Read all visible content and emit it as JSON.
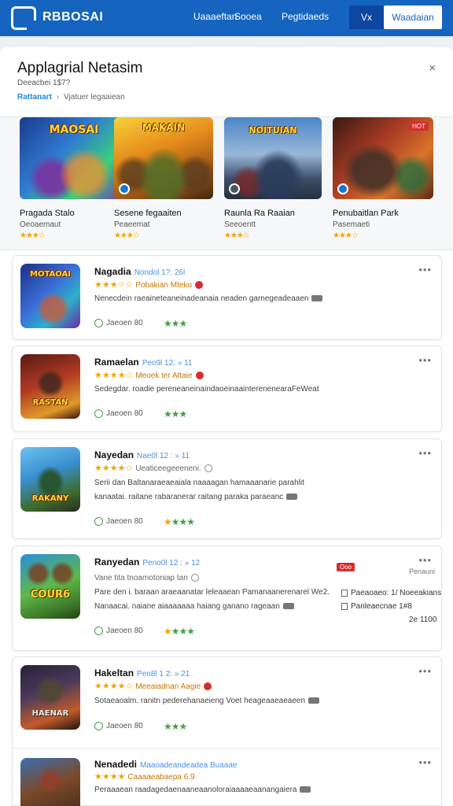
{
  "nav": {
    "brand": "RBBOSAI",
    "links": [
      "Uaaaeftan",
      "Sooea",
      "Pegtidaeds"
    ],
    "btn_a": "Vx",
    "btn_b": "Waadaian"
  },
  "header": {
    "title": "Applagrial Netasim",
    "subtitle": "Deeacbei 1$7?",
    "crumb_1": "Rattanart",
    "crumb_sep": "›",
    "crumb_2": "Vjatuer legaaiean",
    "close": "×"
  },
  "featured": [
    {
      "art_title": "MAOSAI",
      "title": "Pragada Stalo",
      "sub": "Oeoaemaut",
      "stars": "★★★☆"
    },
    {
      "art_title": "MAKAIN",
      "title": "Sesene fegaaiten",
      "sub": "Peaeemat",
      "stars": "★★★☆"
    },
    {
      "art_title": "NOITUIAN",
      "title": "Raunla Ra Raaian",
      "sub": "Seeoentt",
      "stars": "★★★☆"
    },
    {
      "art_title": "",
      "title": "Penubaitlan Park",
      "sub": "Pasemaeti",
      "stars": "★★★☆",
      "hot": "HOT"
    }
  ],
  "cards": [
    {
      "art_title": "MOTAOAI",
      "title": "Nagadia",
      "meta": "Nondol 1?: 26l",
      "stars": "★★★☆☆",
      "tag": "Pobakian Mteko",
      "desc": [
        "Nenecdein raeaineteaneinadeanaia neaden garnegeadeaaen"
      ],
      "check": "Jaeoen 80",
      "rating": "★★★"
    },
    {
      "art_title": "RASTAN",
      "title": "Ramaelan",
      "meta": "Peo9l 12: » 11",
      "stars": "★★★★☆",
      "tag": "Meoek ter Attaie",
      "desc": [
        "Sedegdar. roadie pereneaneinaindaoeinaainterenenearaFeWeat"
      ],
      "check": "Jaeoen 80",
      "rating": "★★★"
    },
    {
      "art_title": "RAKANY",
      "title": "Nayedan",
      "meta": "Nae0l 12 : » 11",
      "stars": "★★★★☆",
      "tag": "Ueaticeegeeeneni.",
      "desc": [
        "Serii dan  Baltanaraeaeaiala naaaagan hamaaanarie parahlit",
        "kanaatai. raitane rabaranerar raitang paraka paraeanc"
      ],
      "check": "Jaeoen 80",
      "rating": "★★★"
    },
    {
      "art_title": "COUR6",
      "title": "Ranyedan",
      "meta": "Peno0l 12 : » 12",
      "stars": "",
      "tag": "Vane tita tnoamotoniap tan",
      "desc": [
        "Pare den i. baraan araeaanatar leleaaean Pamanaanerenarel We2.",
        "Nanaacai. naiane aiaaaaaaa haiang ganano rageaan"
      ],
      "check": "Jaeoen 80",
      "rating": "★★★",
      "side_badge": "Ooo",
      "side_label": "Penauni",
      "side_row_1": "Paeaoaeo: 1/ Noeeakians",
      "side_row_2": "Panleaecnae 1#8",
      "side_small": "2e 1100"
    },
    {
      "art_title": "HAENAR",
      "title": "Hakeltan",
      "meta": "Pen8l 1 2: » 21",
      "stars": "★★★★☆",
      "tag": "Meeaiadnan Aagie",
      "desc": [
        "Sotaeaoalm. ranitn pederehanaeieng Voet heageaaeaeaeen"
      ],
      "check": "Jaeoen 80",
      "rating": "★★★"
    },
    {
      "art_title": "",
      "title": "Nenadedi",
      "meta": "Maaoadeandeadea Buaaae",
      "stars": "★★★★",
      "tag": "Caaaaeabaepa 6.9",
      "desc": [
        "Peraaaean raadagedaenaaneaanoloraiaaaaeaanangaiera"
      ],
      "check": "",
      "rating": ""
    }
  ],
  "colors": {
    "primary": "#1565c0",
    "accent": "#1e88e5",
    "star": "#f4a300",
    "green": "#43a047",
    "red": "#d32f2f"
  }
}
